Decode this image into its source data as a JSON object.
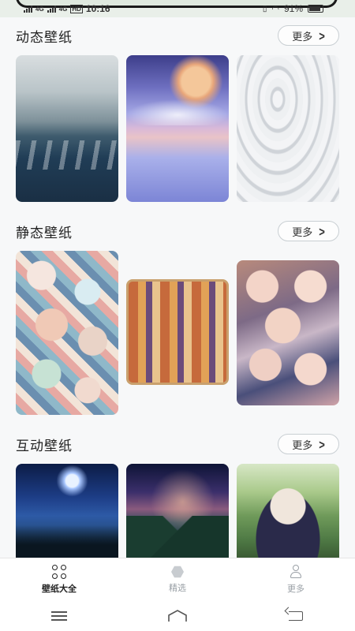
{
  "status_bar": {
    "carrier_left": "4G",
    "carrier_right": "4G",
    "hd_label": "HD",
    "time": "10:16",
    "battery": "91%"
  },
  "sections": [
    {
      "title": "动态壁纸",
      "more_label": "更多"
    },
    {
      "title": "静态壁纸",
      "more_label": "更多"
    },
    {
      "title": "互动壁纸",
      "more_label": "更多"
    }
  ],
  "thumbnails": {
    "dynamic": [
      "ocean-waves-wallpaper",
      "moon-over-sea-wallpaper",
      "water-ripples-wallpaper"
    ],
    "static": [
      "anime-collage-wallpaper",
      "temple-illustration-wallpaper",
      "girl-group-collage-wallpaper"
    ],
    "interactive": [
      "night-moon-wallpaper",
      "galaxy-forest-wallpaper",
      "forest-girl-wallpaper"
    ]
  },
  "bottom_nav": {
    "items": [
      {
        "label": "壁纸大全",
        "icon": "grid-icon",
        "active": true
      },
      {
        "label": "精选",
        "icon": "hexagon-icon",
        "active": false
      },
      {
        "label": "更多",
        "icon": "user-icon",
        "active": false
      }
    ]
  },
  "colors": {
    "background": "#f7f8f9",
    "active_text": "#222222",
    "inactive_text": "#9aa0a6"
  }
}
